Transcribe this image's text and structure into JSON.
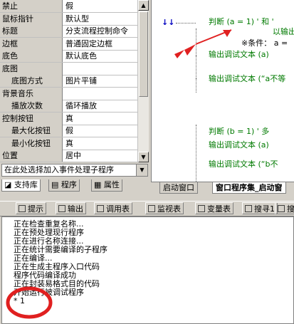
{
  "properties": [
    {
      "name": "禁止",
      "value": "假",
      "sub": false
    },
    {
      "name": "鼠标指针",
      "value": "默认型",
      "sub": false
    },
    {
      "name": "标题",
      "value": "分支流程控制命令",
      "sub": false
    },
    {
      "name": "边框",
      "value": "普通固定边框",
      "sub": false
    },
    {
      "name": "底色",
      "value": "默认底色",
      "sub": false
    },
    {
      "name": "底图",
      "value": "",
      "sub": false
    },
    {
      "name": "底图方式",
      "value": "图片平铺",
      "sub": true
    },
    {
      "name": "背景音乐",
      "value": "",
      "sub": false
    },
    {
      "name": "播放次数",
      "value": "循环播放",
      "sub": true
    },
    {
      "name": "控制按钮",
      "value": "真",
      "sub": false
    },
    {
      "name": "最大化按钮",
      "value": "假",
      "sub": true
    },
    {
      "name": "最小化按钮",
      "value": "真",
      "sub": true
    },
    {
      "name": "位置",
      "value": "居中",
      "sub": false
    }
  ],
  "event_select": "在此处选择加入事件处理子程序",
  "left_tabs": [
    "支持库",
    "程序",
    "属性"
  ],
  "code": {
    "line1_kw": "判断",
    "line1_expr": "(a = 1)",
    "line1_tail": "' 和 '",
    "line2": "以输出",
    "condition_label": "※条件： a =",
    "line3": "输出调试文本 (a)",
    "line4": "输出调试文本 (“a不等",
    "line5_kw": "判断",
    "line5_expr": "(b = 1)",
    "line5_tail": "' 多",
    "line6": "输出调试文本 (a)",
    "line7": "输出调试文本 (“b不"
  },
  "right_tabs": [
    "启动窗口",
    "窗口程序集_启动窗"
  ],
  "toolbar": [
    "提示",
    "输出",
    "调用表",
    "监视表",
    "变量表",
    "搜寻1",
    "搜"
  ],
  "output_lines": [
    "正在检查重复名称...",
    "正在预处理现行程序",
    "正在进行名称连接...",
    "正在统计需要编译的子程序",
    "正在编译...",
    "正在生成主程序入口代码",
    "程序代码编译成功",
    "正在封装易格式目的代码",
    "开始运行被调试程序",
    "* 1"
  ],
  "colors": {
    "annotation_red": "#e02020",
    "keyword_green": "#007a00",
    "ide_gray": "#d4d0c8"
  }
}
